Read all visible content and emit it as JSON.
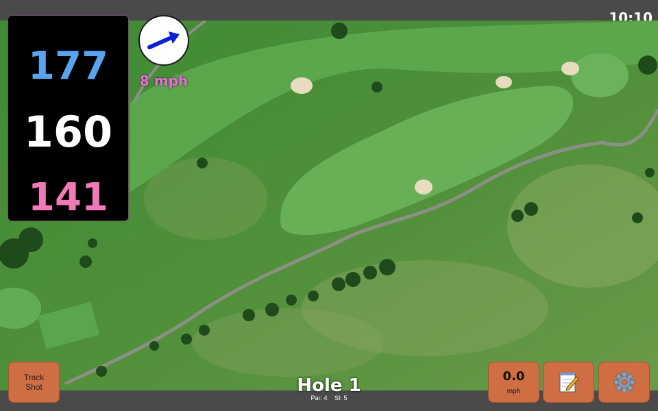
{
  "status": {
    "time": "10:10"
  },
  "distances": {
    "back": "177",
    "middle": "160",
    "front": "141"
  },
  "wind": {
    "speed": "8 mph",
    "icon": "arrow-up-right-icon"
  },
  "hole": {
    "title": "Hole 1",
    "par": "Par: 4",
    "stroke_index": "SI: 5"
  },
  "buttons": {
    "track_shot_line1": "Track",
    "track_shot_line2": "Shot",
    "speed_value": "0.0",
    "speed_unit": "mph",
    "notes_icon": "notepad-icon",
    "settings_icon": "gear-icon"
  },
  "colors": {
    "back_distance": "#5aa3ee",
    "middle_distance": "#ffffff",
    "front_distance": "#f07ab8",
    "button_bg": "#cf6d43",
    "wind_text": "#e870d6"
  }
}
